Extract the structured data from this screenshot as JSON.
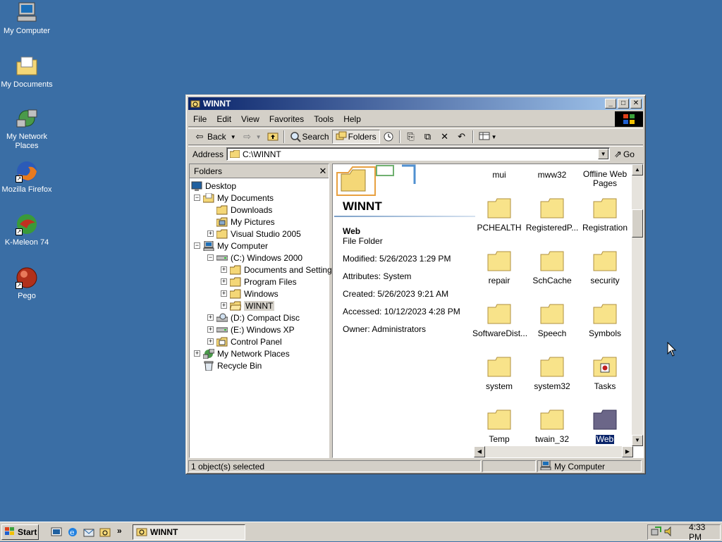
{
  "desktop": {
    "icons": [
      {
        "label": "My Computer",
        "icon": "my-computer-icon"
      },
      {
        "label": "My Documents",
        "icon": "my-documents-icon"
      },
      {
        "label": "My Network Places",
        "icon": "network-places-icon"
      },
      {
        "label": "Mozilla Firefox",
        "icon": "firefox-icon"
      },
      {
        "label": "K-Meleon 74",
        "icon": "kmeleon-icon"
      },
      {
        "label": "Pego",
        "icon": "pego-icon"
      }
    ]
  },
  "window": {
    "title": "WINNT",
    "menu": [
      "File",
      "Edit",
      "View",
      "Favorites",
      "Tools",
      "Help"
    ],
    "toolbar": {
      "back": "Back",
      "search": "Search",
      "folders": "Folders"
    },
    "address": {
      "label": "Address",
      "value": "C:\\WINNT",
      "go": "Go"
    },
    "folders_pane": {
      "header": "Folders",
      "tree": [
        {
          "label": "Desktop"
        },
        {
          "label": "My Documents"
        },
        {
          "label": "Downloads"
        },
        {
          "label": "My Pictures"
        },
        {
          "label": "Visual Studio 2005"
        },
        {
          "label": "My Computer"
        },
        {
          "label": "(C:) Windows 2000"
        },
        {
          "label": "Documents and Settings"
        },
        {
          "label": "Program Files"
        },
        {
          "label": "Windows"
        },
        {
          "label": "WINNT"
        },
        {
          "label": "(D:) Compact Disc"
        },
        {
          "label": "(E:) Windows XP"
        },
        {
          "label": "Control Panel"
        },
        {
          "label": "My Network Places"
        },
        {
          "label": "Recycle Bin"
        }
      ]
    },
    "info": {
      "folder_title": "WINNT",
      "selected_name": "Web",
      "selected_type": "File Folder",
      "modified": "Modified: 5/26/2023 1:29 PM",
      "attributes": "Attributes: System",
      "created": "Created: 5/26/2023 9:21 AM",
      "accessed": "Accessed: 10/12/2023 4:28 PM",
      "owner": "Owner: Administrators"
    },
    "files": [
      {
        "label": "mui"
      },
      {
        "label": "mww32"
      },
      {
        "label": "Offline Web Pages"
      },
      {
        "label": "PCHEALTH"
      },
      {
        "label": "RegisteredP..."
      },
      {
        "label": "Registration"
      },
      {
        "label": "repair"
      },
      {
        "label": "SchCache"
      },
      {
        "label": "security"
      },
      {
        "label": "SoftwareDist..."
      },
      {
        "label": "Speech"
      },
      {
        "label": "Symbols"
      },
      {
        "label": "system"
      },
      {
        "label": "system32"
      },
      {
        "label": "Tasks"
      },
      {
        "label": "Temp"
      },
      {
        "label": "twain_32"
      },
      {
        "label": "Web"
      }
    ],
    "status": {
      "selected": "1 object(s) selected",
      "zone": "My Computer"
    }
  },
  "taskbar": {
    "start": "Start",
    "task": "WINNT",
    "clock": "4:33 PM"
  }
}
